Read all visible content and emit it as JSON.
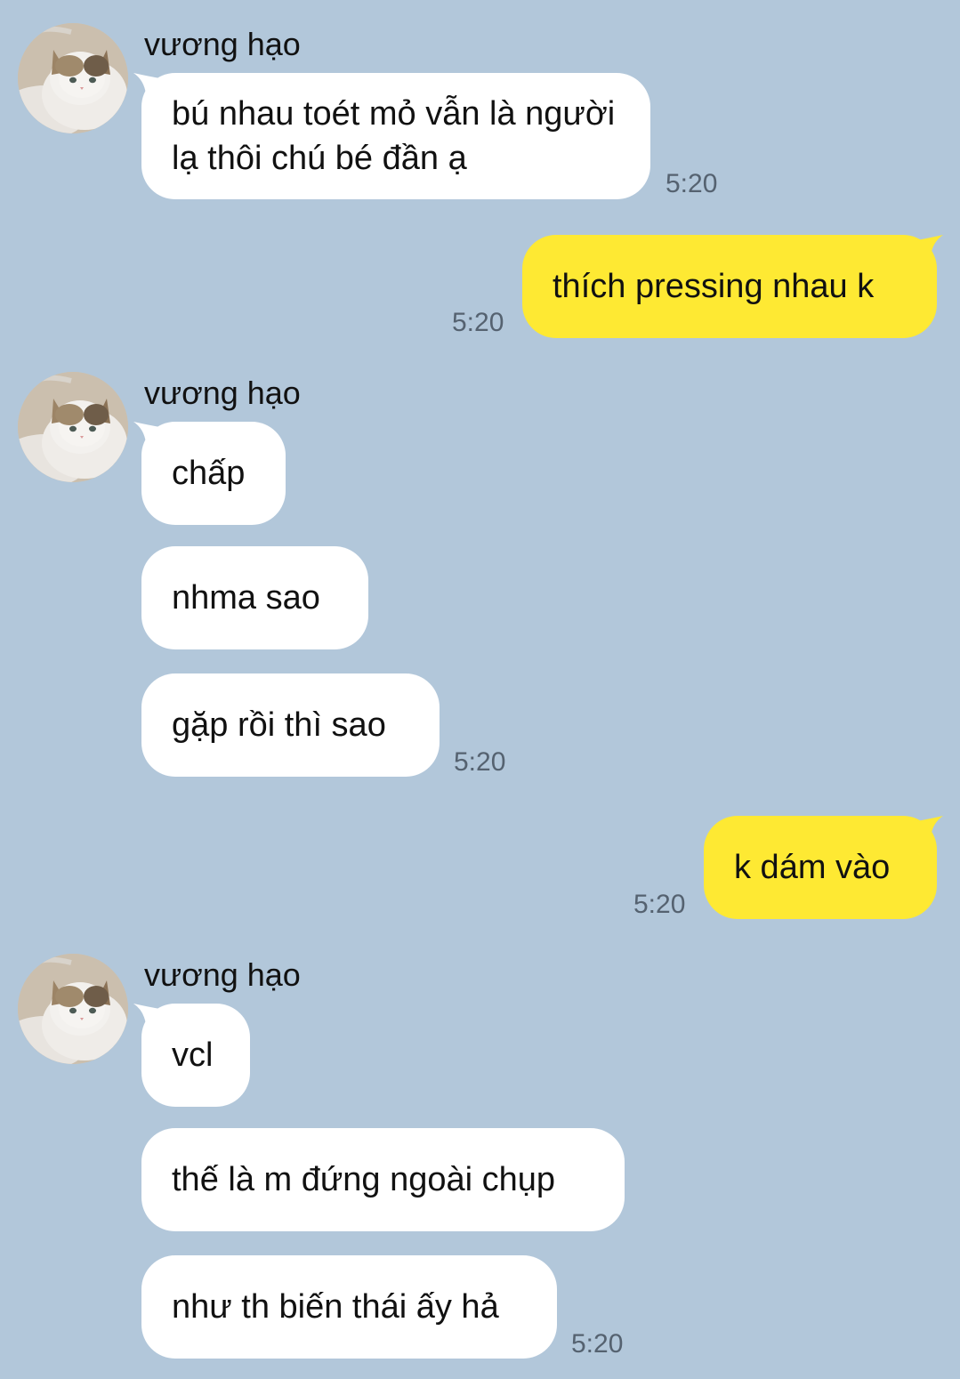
{
  "colors": {
    "background": "#b2c7da",
    "incoming_bubble": "#ffffff",
    "outgoing_bubble": "#fee933",
    "timestamp": "#556270"
  },
  "messages": {
    "g1": {
      "sender": "vương hạo",
      "avatar": "cat-avatar-icon",
      "m1": "bú nhau toét mỏ vẫn là người lạ thôi chú bé đần ạ",
      "time": "5:20"
    },
    "o1": {
      "text": "thích pressing nhau k",
      "time": "5:20"
    },
    "g2": {
      "sender": "vương hạo",
      "avatar": "cat-avatar-icon",
      "m1": "chấp",
      "m2": "nhma sao",
      "m3": "gặp rồi thì sao",
      "time": "5:20"
    },
    "o2": {
      "text": "k dám vào",
      "time": "5:20"
    },
    "g3": {
      "sender": "vương hạo",
      "avatar": "cat-avatar-icon",
      "m1": "vcl",
      "m2": "thế là m đứng ngoài chụp",
      "m3": "như th biến thái ấy hả",
      "time": "5:20"
    }
  }
}
